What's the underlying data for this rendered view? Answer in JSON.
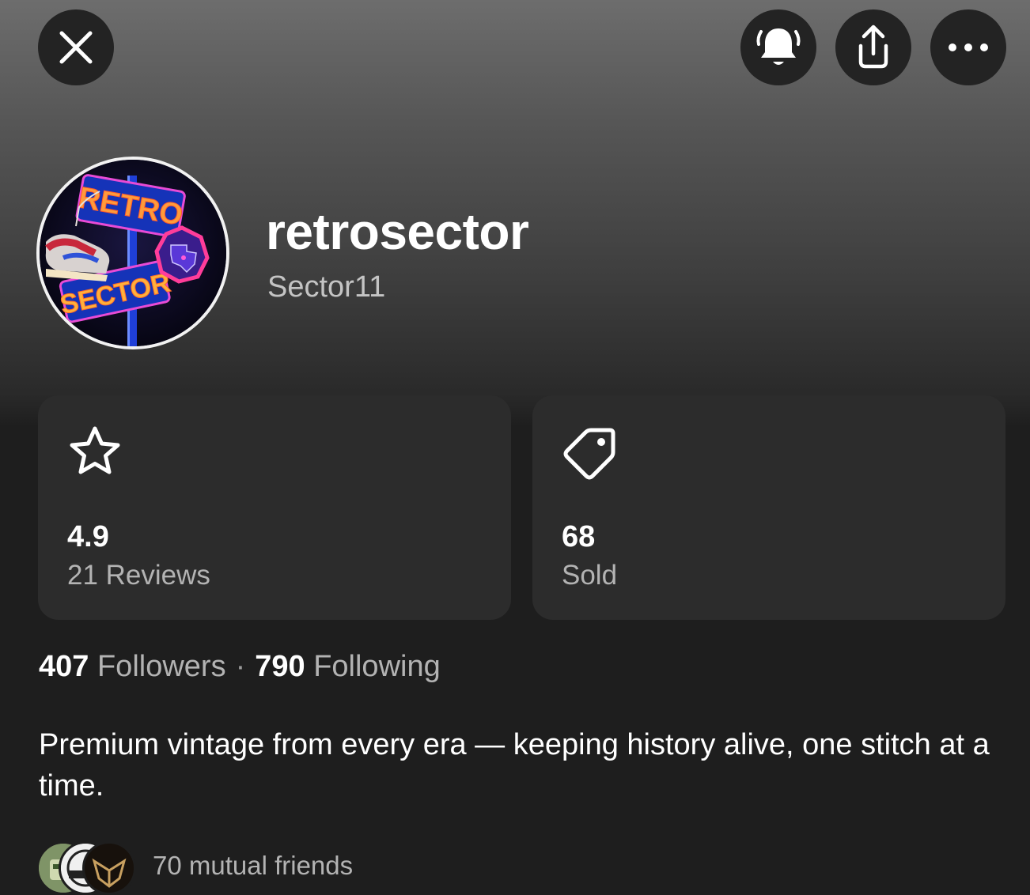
{
  "header": {
    "close_icon": "close-icon",
    "bell_icon": "bell-ring-icon",
    "share_icon": "share-icon",
    "more_icon": "more-horizontal-icon"
  },
  "profile": {
    "username": "retrosector",
    "handle": "Sector11",
    "avatar_text": [
      "RETRO",
      "SECTOR"
    ]
  },
  "stats": {
    "rating": {
      "icon": "star-icon",
      "value": "4.9",
      "label": "21 Reviews"
    },
    "sold": {
      "icon": "tag-icon",
      "value": "68",
      "label": "Sold"
    }
  },
  "social": {
    "followers_count": "407",
    "followers_label": "Followers",
    "separator": "·",
    "following_count": "790",
    "following_label": "Following"
  },
  "bio": "Premium vintage from every era — keeping history alive, one stitch at a time.",
  "mutual": {
    "text": "70 mutual friends",
    "avatar_count": 3
  },
  "colors": {
    "background": "#1e1e1e",
    "card": "#2c2c2c",
    "button": "#232323",
    "secondary_text": "#b3b3b3"
  }
}
